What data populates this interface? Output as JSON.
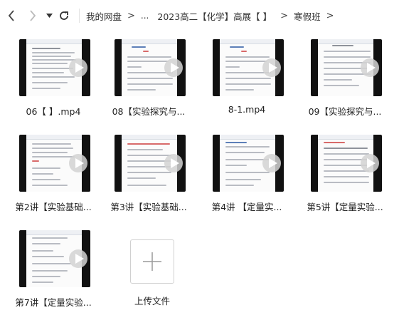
{
  "nav": {
    "back_icon": "chevron-left-icon",
    "forward_icon": "chevron-right-icon",
    "history_icon": "dropdown-triangle-icon",
    "refresh_icon": "refresh-icon"
  },
  "breadcrumb": {
    "root": "我的网盘",
    "ellipsis": "...",
    "folder_1": "2023高二【化学】高展【 】",
    "folder_2": "寒假班",
    "separator": ">"
  },
  "files": [
    {
      "name": "06【 】.mp4",
      "type": "video"
    },
    {
      "name": "08【实验探究与...",
      "type": "video"
    },
    {
      "name": "8-1.mp4",
      "type": "video"
    },
    {
      "name": "09【实验探究与...",
      "type": "video"
    },
    {
      "name": "第2讲【实验基础...",
      "type": "video"
    },
    {
      "name": "第3讲【实验基础...",
      "type": "video"
    },
    {
      "name": "第4讲 【定量实...",
      "type": "video"
    },
    {
      "name": "第5讲【定量实验...",
      "type": "video"
    },
    {
      "name": "第7讲【定量实验...",
      "type": "video"
    }
  ],
  "upload": {
    "label": "上传文件",
    "icon": "plus-icon"
  },
  "colors": {
    "thumb_bg": "#111111",
    "play_button": "#d2d2d2"
  }
}
